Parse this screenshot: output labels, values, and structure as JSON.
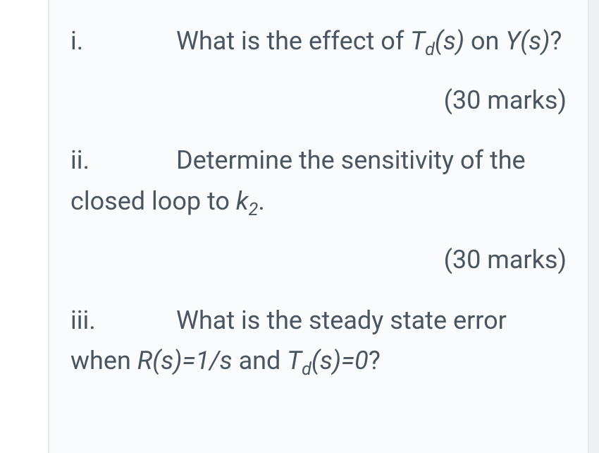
{
  "questions": [
    {
      "numeral": "i.",
      "text_before": "What is the effect of ",
      "var1": "T",
      "var1_sub": "d",
      "var1_suffix": "(s)",
      "text_middle": " on ",
      "var2": "Y(s)",
      "text_after": "?",
      "marks": "(30 marks)"
    },
    {
      "numeral": "ii.",
      "text_before": "Determine the sensitivity of the closed loop to ",
      "var1": "k",
      "var1_sub": "2",
      "text_after": ".",
      "marks": "(30 marks)"
    },
    {
      "numeral": "iii.",
      "text_before": "What is the steady state error when ",
      "var1": "R(s)=1/s",
      "text_middle": " and ",
      "var2": "T",
      "var2_sub": "d",
      "var2_suffix": "(s)=0",
      "text_after": "?"
    }
  ]
}
